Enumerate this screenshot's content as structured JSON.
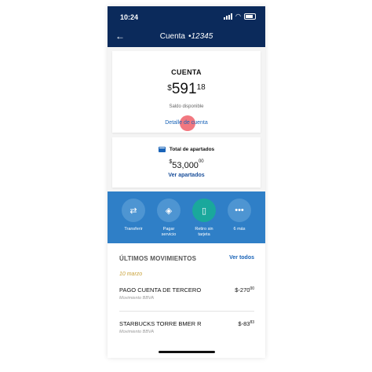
{
  "status": {
    "time": "10:24"
  },
  "header": {
    "title": "Cuenta",
    "account": "•12345"
  },
  "account_card": {
    "title": "CUENTA",
    "currency": "$",
    "amount_int": "591",
    "amount_cents": "18",
    "balance_label": "Saldo disponible",
    "detail_link": "Detalle de cuenta"
  },
  "savings_card": {
    "title": "Total de apartados",
    "currency": "$",
    "amount_int": "53,000",
    "amount_cents": "00",
    "link": "Ver apartados"
  },
  "actions": [
    {
      "label": "Transferir",
      "icon": "transfer-icon"
    },
    {
      "label": "Pagar servicio",
      "icon": "tag-icon"
    },
    {
      "label": "Retiro sin tarjeta",
      "icon": "phone-cash-icon"
    },
    {
      "label": "6 más",
      "icon": "more-icon"
    }
  ],
  "movements": {
    "title": "ÚLTIMOS MOVIMIENTOS",
    "see_all": "Ver todos",
    "date": "10 marzo",
    "items": [
      {
        "name": "PAGO CUENTA DE TERCERO",
        "sub": "Movimiento BBVA",
        "amount": "-270",
        "cents": "00"
      },
      {
        "name": "STARBUCKS TORRE BMER R",
        "sub": "Movimiento BBVA",
        "amount": "-83",
        "cents": "83"
      }
    ]
  },
  "colors": {
    "header": "#0b2a5b",
    "actions_bg": "#2f7fc7",
    "accent_teal": "#1aa89c",
    "link": "#1a64b8",
    "date": "#c9a23a"
  }
}
